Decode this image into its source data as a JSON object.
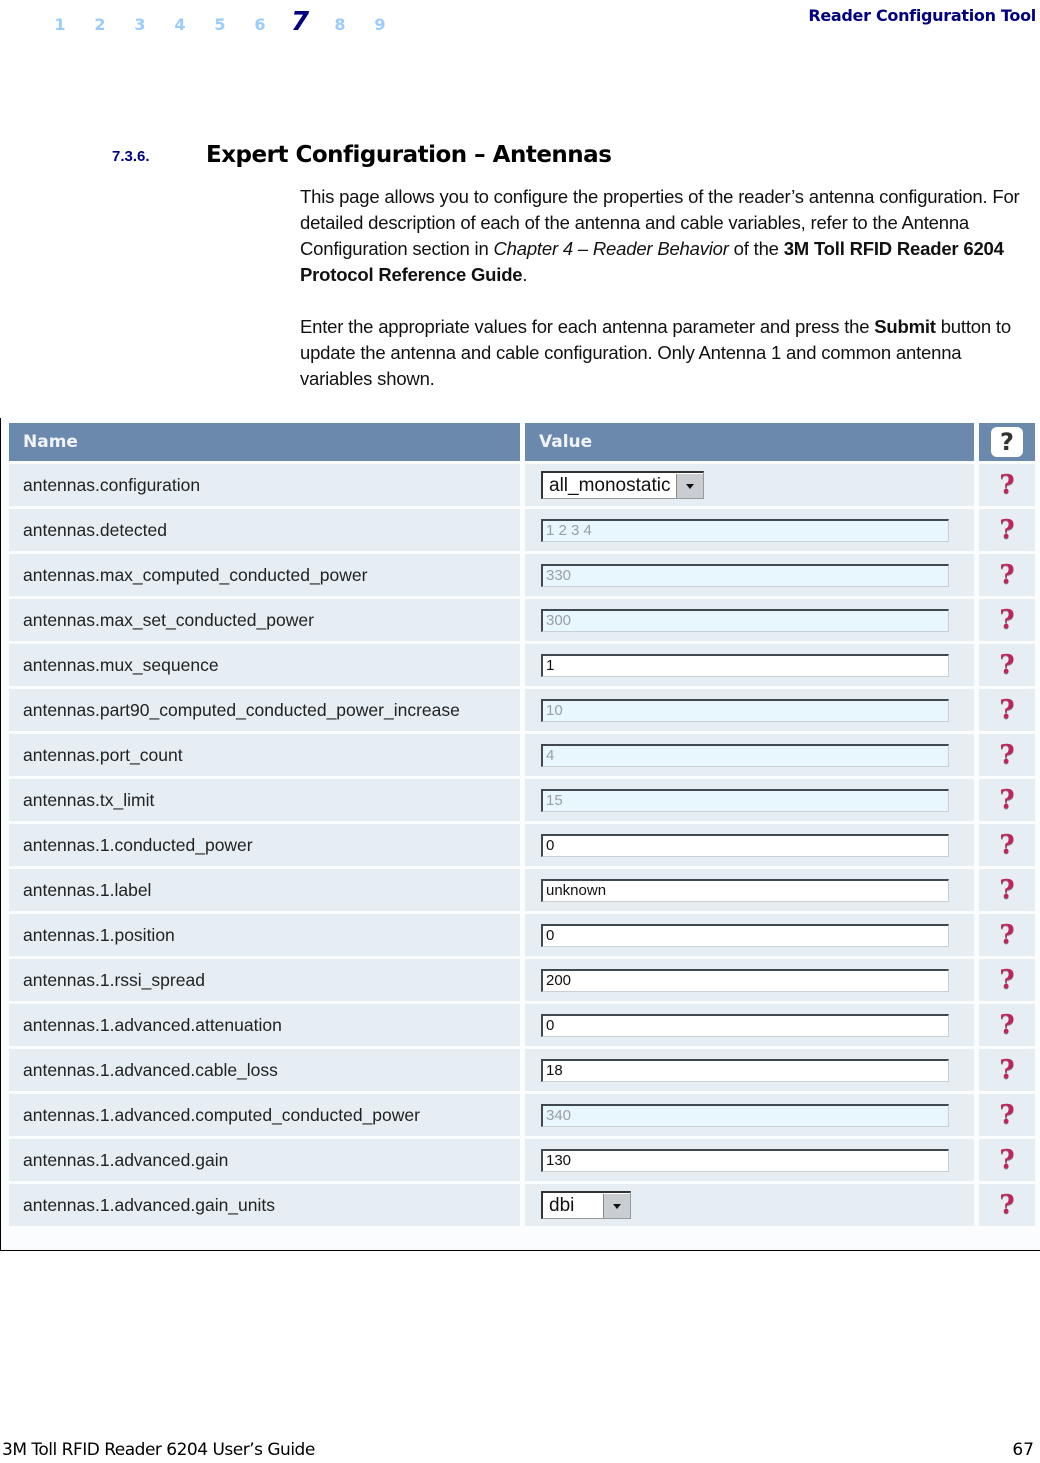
{
  "header": {
    "chapters": [
      "1",
      "2",
      "3",
      "4",
      "5",
      "6",
      "7",
      "8",
      "9"
    ],
    "active_chapter": "7",
    "doc_title": "Reader Configuration Tool"
  },
  "section": {
    "number": "7.3.6.",
    "title": "Expert Configuration – Antennas"
  },
  "paragraph1": {
    "text_a": "This page allows you to configure the properties of the reader’s antenna configuration. For detailed description of each of the antenna and cable variables, refer to the Antenna Configuration section in ",
    "italic": "Chapter 4 – Reader Behavior",
    "text_b": " of the ",
    "bold": "3M Toll RFID Reader 6204 Protocol Reference Guide",
    "text_c": "."
  },
  "paragraph2": {
    "text_a": "Enter the appropriate values for each antenna parameter and press the ",
    "bold": "Submit",
    "text_b": " button to update the antenna and cable configuration. Only Antenna 1 and common antenna variables shown."
  },
  "table": {
    "headers": {
      "name": "Name",
      "value": "Value",
      "help": "?"
    },
    "help_icon": "help-question-icon",
    "rows": [
      {
        "name": "antennas.configuration",
        "type": "select",
        "value": "all_monostatic"
      },
      {
        "name": "antennas.detected",
        "type": "readonly",
        "value": "1 2 3 4"
      },
      {
        "name": "antennas.max_computed_conducted_power",
        "type": "readonly",
        "value": "330"
      },
      {
        "name": "antennas.max_set_conducted_power",
        "type": "readonly",
        "value": "300"
      },
      {
        "name": "antennas.mux_sequence",
        "type": "input",
        "value": "1"
      },
      {
        "name": "antennas.part90_computed_conducted_power_increase",
        "type": "readonly",
        "value": "10"
      },
      {
        "name": "antennas.port_count",
        "type": "readonly",
        "value": "4"
      },
      {
        "name": "antennas.tx_limit",
        "type": "readonly",
        "value": "15"
      },
      {
        "name": "antennas.1.conducted_power",
        "type": "input",
        "value": "0"
      },
      {
        "name": "antennas.1.label",
        "type": "input",
        "value": "unknown"
      },
      {
        "name": "antennas.1.position",
        "type": "input",
        "value": "0"
      },
      {
        "name": "antennas.1.rssi_spread",
        "type": "input",
        "value": "200"
      },
      {
        "name": "antennas.1.advanced.attenuation",
        "type": "input",
        "value": "0"
      },
      {
        "name": "antennas.1.advanced.cable_loss",
        "type": "input",
        "value": "18"
      },
      {
        "name": "antennas.1.advanced.computed_conducted_power",
        "type": "readonly",
        "value": "340"
      },
      {
        "name": "antennas.1.advanced.gain",
        "type": "input",
        "value": "130"
      },
      {
        "name": "antennas.1.advanced.gain_units",
        "type": "select-small",
        "value": "dbi"
      }
    ]
  },
  "footer": {
    "left": "3M Toll RFID Reader 6204 User’s Guide",
    "page_number": "67"
  },
  "colors": {
    "nav_inactive": "#99ccff",
    "nav_active": "#000080",
    "table_header": "#6a89ad",
    "row_bg": "#e6eef3",
    "readonly_bg": "#e8f6fd",
    "help_mark": "#c0245a"
  }
}
